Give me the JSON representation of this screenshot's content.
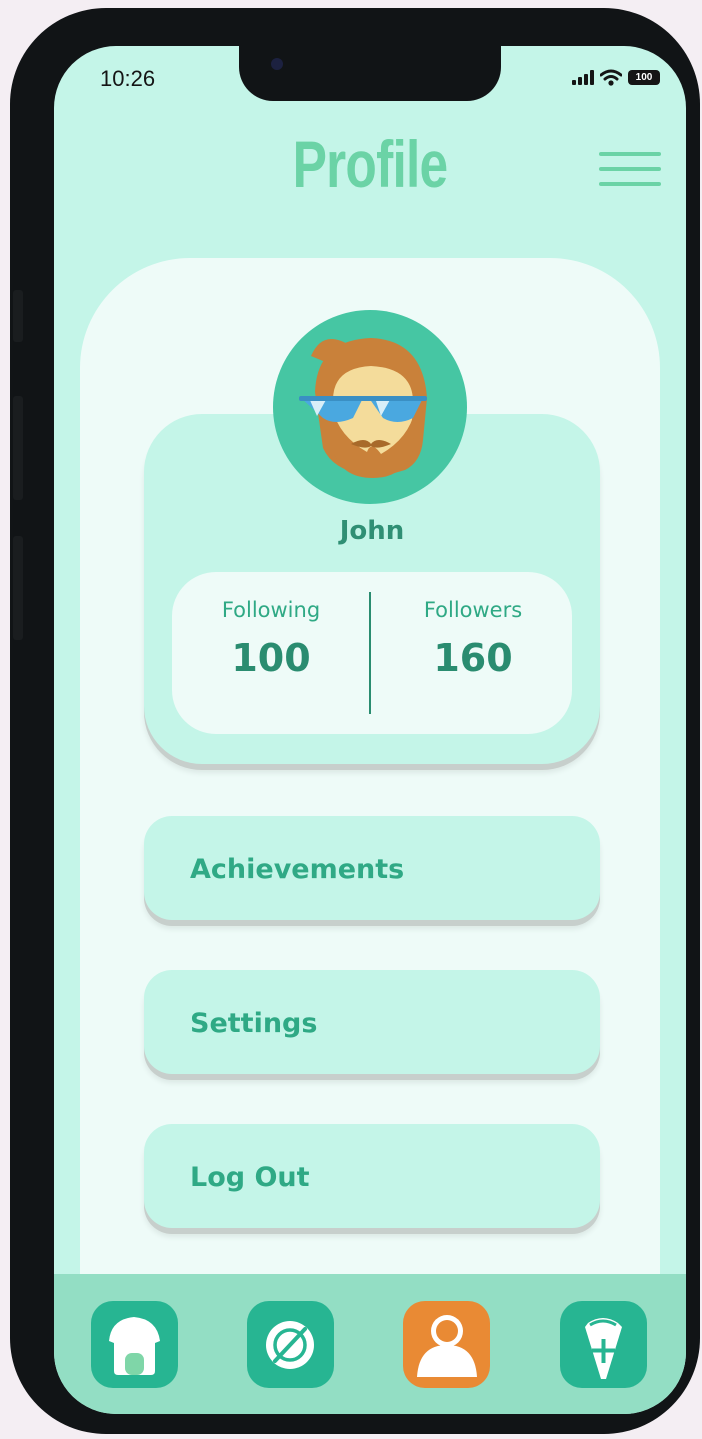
{
  "status_bar": {
    "time": "10:26",
    "battery": "100"
  },
  "header": {
    "title": "Profile"
  },
  "profile": {
    "name": "John",
    "following_label": "Following",
    "following_value": "100",
    "followers_label": "Followers",
    "followers_value": "160"
  },
  "menu": [
    {
      "label": "Achievements"
    },
    {
      "label": "Settings"
    },
    {
      "label": "Log Out"
    }
  ],
  "tabbar": {
    "items": [
      {
        "icon": "home-icon",
        "active": false
      },
      {
        "icon": "compass-icon",
        "active": false
      },
      {
        "icon": "profile-icon",
        "active": true
      },
      {
        "icon": "add-icon",
        "active": false
      }
    ]
  },
  "colors": {
    "screen_bg": "#c4f5e8",
    "panel_bg": "#eefbf8",
    "accent": "#2fa985",
    "title": "#6bd3a6",
    "tab_bg": "#93dec4",
    "tab_button": "#27b592",
    "tab_active": "#e98a34"
  }
}
